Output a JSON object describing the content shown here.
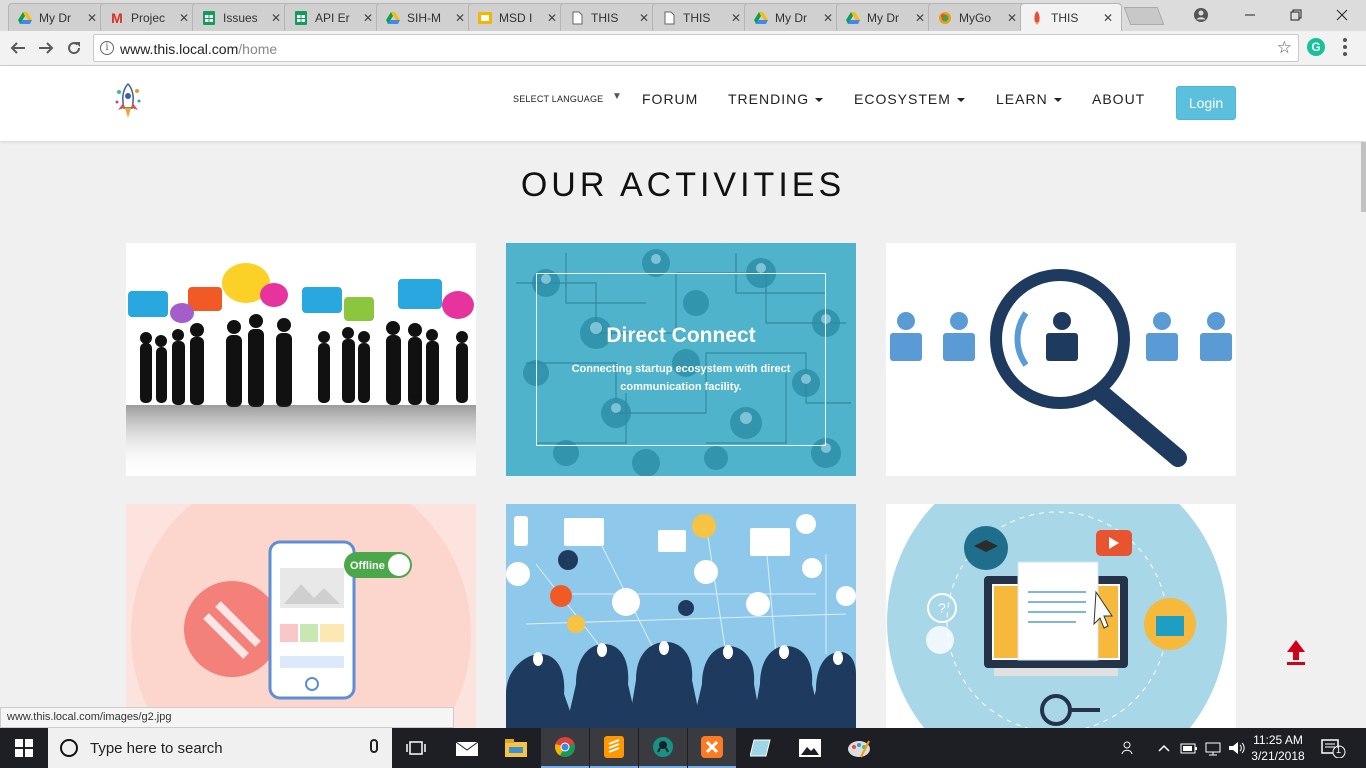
{
  "browser": {
    "tabs": [
      {
        "label": "My Dr",
        "icon": "google-drive-icon"
      },
      {
        "label": "Projec",
        "icon": "gmail-icon"
      },
      {
        "label": "Issues",
        "icon": "google-sheets-icon"
      },
      {
        "label": "API Er",
        "icon": "google-sheets-icon"
      },
      {
        "label": "SIH-M",
        "icon": "google-drive-icon"
      },
      {
        "label": "MSD I",
        "icon": "google-slides-icon"
      },
      {
        "label": "THIS",
        "icon": "page-icon"
      },
      {
        "label": "THIS",
        "icon": "page-icon"
      },
      {
        "label": "My Dr",
        "icon": "google-drive-icon"
      },
      {
        "label": "My Dr",
        "icon": "google-drive-icon"
      },
      {
        "label": "MyGo",
        "icon": "mygov-icon"
      },
      {
        "label": "THIS",
        "icon": "rocket-icon"
      }
    ],
    "url_host": "www.this.local.com",
    "url_path": "/home",
    "status_url": "www.this.local.com/images/g2.jpg"
  },
  "site": {
    "language_label": "SELECT LANGUAGE",
    "nav": {
      "forum": "FORUM",
      "trending": "TRENDING",
      "ecosystem": "ECOSYSTEM",
      "learn": "LEARN",
      "about": "ABOUT"
    },
    "login_label": "Login",
    "section_heading": "OUR ACTIVITIES",
    "cards": [
      {
        "image": "people-talking-silhouettes"
      },
      {
        "image": "network-avatars",
        "title": "Direct Connect",
        "description": "Connecting startup ecosystem with direct communication facility."
      },
      {
        "image": "magnifier-search-people"
      },
      {
        "image": "offline-mobile-app",
        "badge": "Offline"
      },
      {
        "image": "business-ideas-heads"
      },
      {
        "image": "e-learning-laptop"
      }
    ]
  },
  "taskbar": {
    "search_placeholder": "Type here to search",
    "time": "11:25 AM",
    "date": "3/21/2018",
    "notification_count": "1"
  },
  "colors": {
    "login_button": "#5bc0de",
    "card_teal": "#4fb3cb",
    "card_sky": "#8ec8ea",
    "card_peach": "#fde3dd",
    "scroll_top_arrow": "#d0021b"
  }
}
